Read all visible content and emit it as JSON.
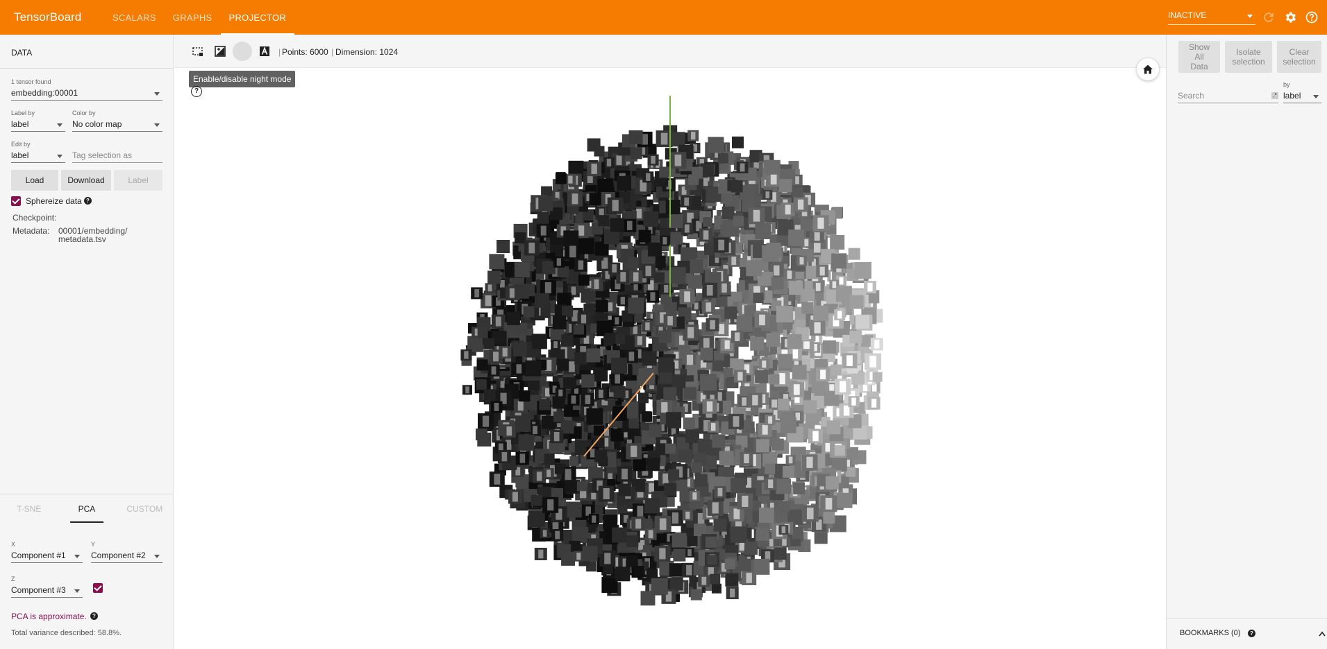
{
  "header": {
    "brand": "TensorBoard",
    "tabs": [
      "SCALARS",
      "GRAPHS",
      "PROJECTOR"
    ],
    "active_tab": "PROJECTOR",
    "run_status": "INACTIVE",
    "icons": [
      "refresh-icon",
      "settings-icon",
      "help-icon"
    ],
    "color": "#f57c00"
  },
  "data_panel": {
    "title": "DATA",
    "tensor_label": "1 tensor found",
    "tensor_value": "embedding:00001",
    "label_by_label": "Label by",
    "label_by_value": "label",
    "color_by_label": "Color by",
    "color_by_value": "No color map",
    "edit_by_label": "Edit by",
    "edit_by_value": "label",
    "tag_placeholder": "Tag selection as",
    "buttons": {
      "load": "Load",
      "download": "Download",
      "label": "Label"
    },
    "sphereize": "Sphereize data",
    "checkpoint_label": "Checkpoint:",
    "metadata_label": "Metadata:",
    "metadata_line1": "00001/embedding/",
    "metadata_line2": "metadata.tsv"
  },
  "projection": {
    "tabs": [
      "T-SNE",
      "PCA",
      "CUSTOM"
    ],
    "active_tab": "PCA",
    "x_label": "X",
    "x_value": "Component #1",
    "y_label": "Y",
    "y_value": "Component #2",
    "z_label": "Z",
    "z_value": "Component #3",
    "approx_note": "PCA is approximate.",
    "variance": "Total variance described: 58.8%.",
    "accent": "#880e4f"
  },
  "toolbar": {
    "points": "Points: 6000",
    "dimension": "Dimension: 1024",
    "tooltip": "Enable/disable night mode",
    "icons": [
      "select-icon",
      "edit-icon",
      "night-mode-icon",
      "label-icon"
    ]
  },
  "inspector": {
    "show_all": "Show All Data",
    "isolate": "Isolate selection",
    "clear": "Clear selection",
    "search_placeholder": "Search",
    "by_label": "by",
    "by_value": "label",
    "bookmarks": "BOOKMARKS (0)"
  }
}
